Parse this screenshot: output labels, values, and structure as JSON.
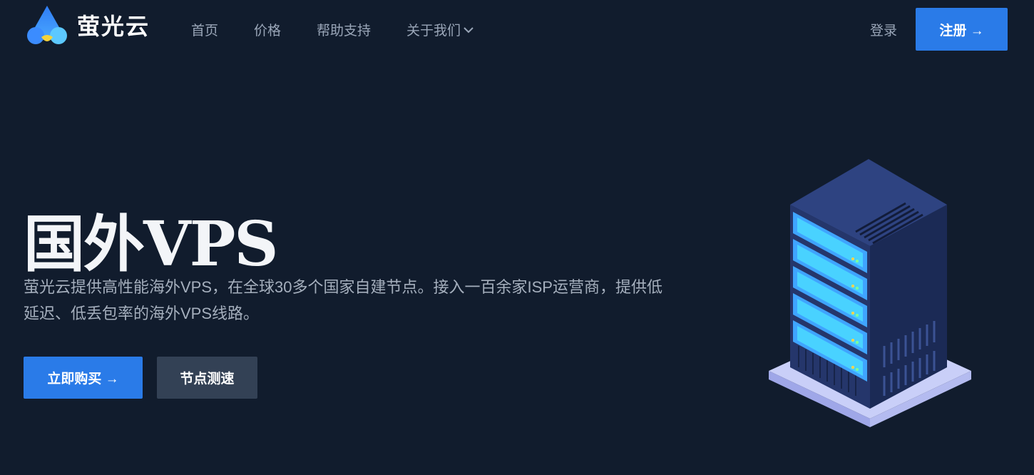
{
  "brand": {
    "name": "萤光云"
  },
  "nav": {
    "items": [
      "首页",
      "价格",
      "帮助支持",
      "关于我们"
    ],
    "login": "登录",
    "signup": "注册 →"
  },
  "hero": {
    "title": "国外VPS",
    "description": "萤光云提供高性能海外VPS，在全球30多个国家自建节点。接入一百余家ISP运营商，提供低延迟、低丢包率的海外VPS线路。",
    "buy_button": "立即购买 →",
    "speed_button": "节点测速"
  },
  "colors": {
    "background": "#111c2d",
    "accent": "#2a7be8",
    "secondary_button": "#334155"
  },
  "icons": {
    "logo": "firefly-logo-icon",
    "dropdown": "chevron-down-icon",
    "illustration": "server-rack-illustration"
  }
}
